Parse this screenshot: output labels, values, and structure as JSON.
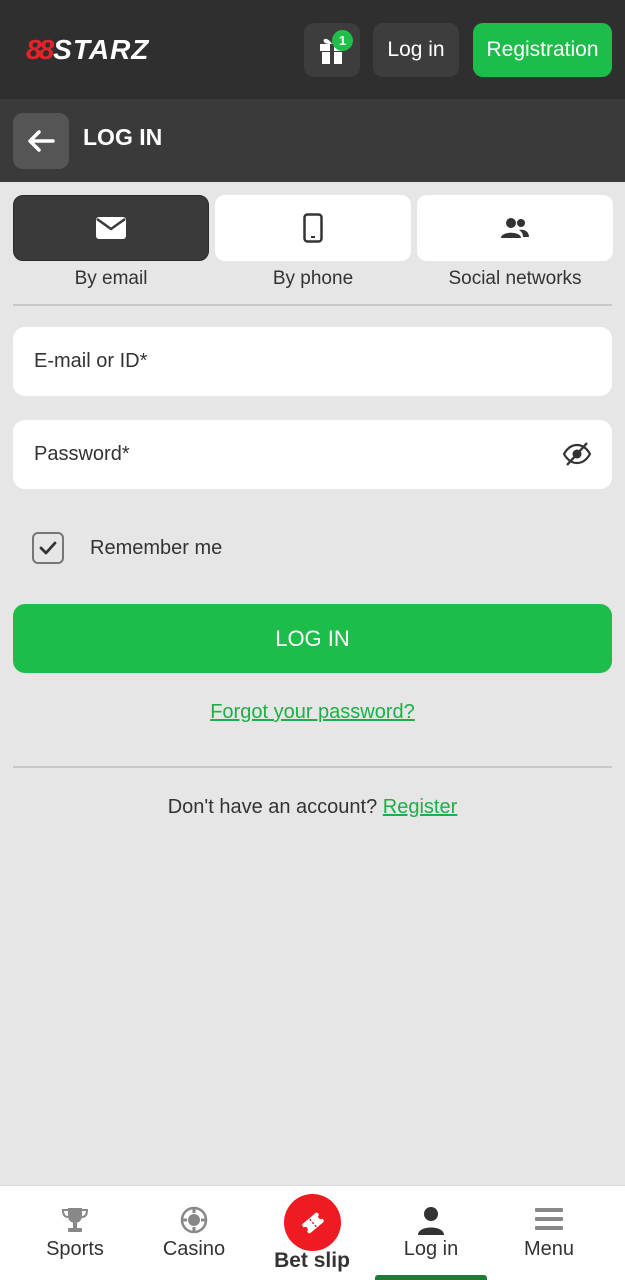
{
  "header": {
    "logo_prefix": "88",
    "logo_text": "STARZ",
    "gift_count": "1",
    "login_label": "Log in",
    "registration_label": "Registration"
  },
  "subheader": {
    "title": "LOG IN"
  },
  "methods": [
    {
      "label": "By email",
      "icon": "envelope-icon",
      "active": true
    },
    {
      "label": "By phone",
      "icon": "phone-icon",
      "active": false
    },
    {
      "label": "Social networks",
      "icon": "users-icon",
      "active": false
    }
  ],
  "form": {
    "email_placeholder": "E-mail or ID*",
    "password_placeholder": "Password*",
    "remember_label": "Remember me",
    "remember_checked": true,
    "submit_label": "LOG IN",
    "forgot_label": "Forgot your password?",
    "no_account_text": "Don't have an account?",
    "register_link": "Register"
  },
  "bottom_nav": [
    {
      "label": "Sports",
      "icon": "trophy-icon"
    },
    {
      "label": "Casino",
      "icon": "casino-chip-icon"
    },
    {
      "label": "Bet slip",
      "icon": "ticket-icon"
    },
    {
      "label": "Log in",
      "icon": "user-icon",
      "active": true
    },
    {
      "label": "Menu",
      "icon": "hamburger-icon"
    }
  ],
  "colors": {
    "accent": "#1cbd4a",
    "brand_red": "#ef1b23",
    "header_bg": "#2f2f2f"
  }
}
